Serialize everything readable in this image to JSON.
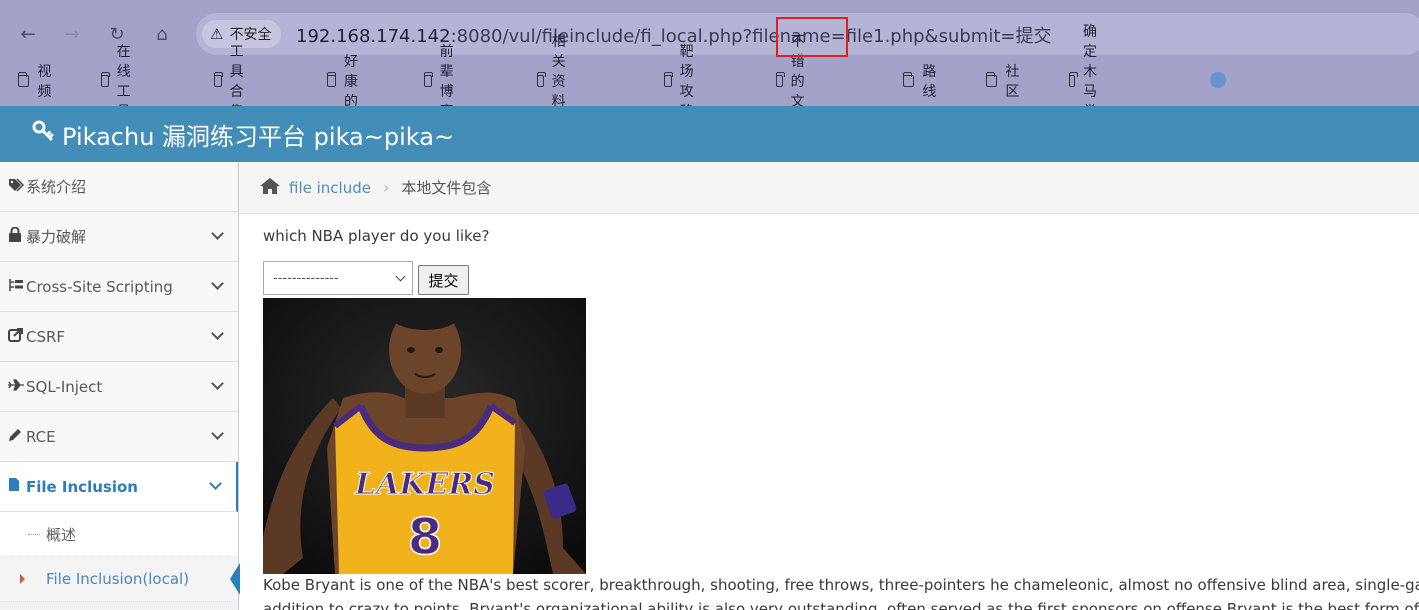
{
  "browser": {
    "nav": {
      "back": "←",
      "forward": "→",
      "reload": "↻",
      "home": "⌂"
    },
    "security_label": "不安全",
    "url_host": "192.168.174.142",
    "url_rest": ":8080/vul/fileinclude/fi_local.php?filename=file1.php&submit=提交",
    "bookmarks": [
      "视频",
      "在线工具",
      "工具合集",
      "好康的",
      "前辈博客",
      "相关资料网",
      "靶场攻略",
      "不错的文章",
      "路线",
      "社区",
      "确定木马类型"
    ]
  },
  "app": {
    "title": "Pikachu 漏洞练习平台 pika~pika~"
  },
  "sidebar": {
    "items": [
      {
        "label": "系统介绍",
        "icon": "tags-icon"
      },
      {
        "label": "暴力破解",
        "icon": "lock-icon"
      },
      {
        "label": "Cross-Site Scripting",
        "icon": "sitemap-icon"
      },
      {
        "label": "CSRF",
        "icon": "share-icon"
      },
      {
        "label": "SQL-Inject",
        "icon": "plane-icon"
      },
      {
        "label": "RCE",
        "icon": "pencil-icon"
      },
      {
        "label": "File Inclusion",
        "icon": "file-icon"
      }
    ],
    "sub_items": [
      "概述",
      "File Inclusion(local)"
    ]
  },
  "breadcrumb": {
    "link": "file include",
    "current": "本地文件包含"
  },
  "main": {
    "question": "which NBA player do you like?",
    "select_value": "--------------",
    "submit_label": "提交",
    "jersey_team": "LAKERS",
    "jersey_number": "8",
    "bio_line1": "Kobe Bryant is one of the NBA's best scorer, breakthrough, shooting, free throws, three-pointers he chameleonic, almost no offensive blind area, single-ga",
    "bio_line2": "addition to crazy to points, Bryant's organizational ability is also very outstanding, often served as the first sponsors on offense Bryant is the best form of"
  },
  "colors": {
    "browser_chrome": "#a3a3c9",
    "header": "#438eb9",
    "highlight_box": "#e0201c",
    "active_blue": "#2b7dbc"
  }
}
